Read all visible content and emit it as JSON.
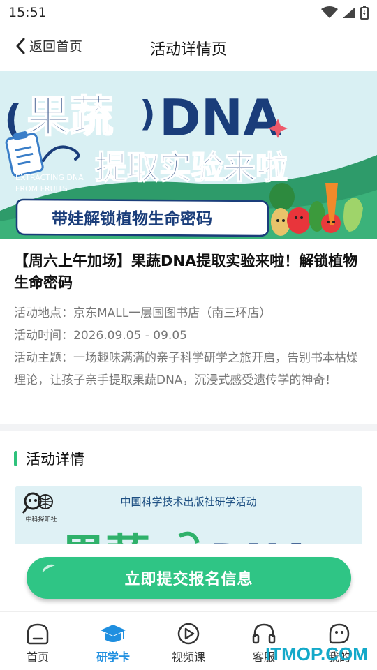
{
  "status_bar": {
    "time": "15:51"
  },
  "nav": {
    "back_label": "返回首页",
    "title": "活动详情页"
  },
  "banner": {
    "title_cn": "果蔬",
    "title_en": "DNA",
    "subtitle": "提取实验来啦",
    "english_line1": "EXTRACTING DNA",
    "english_line2": "FROM FRUITS",
    "ribbon": "带娃解锁植物生命密码"
  },
  "activity": {
    "headline": "【周六上午加场】果蔬DNA提取实验来啦！解锁植物生命密码",
    "location_label": "活动地点：",
    "location": "京东MALL一层国图书店（南三环店）",
    "time_label": "活动时间：",
    "time": "2026.09.05 - 09.05",
    "theme_label": "活动主题：",
    "theme": "一场趣味满满的亲子科学研学之旅开启，告别书本枯燥理论，让孩子亲手提取果蔬DNA，沉浸式感受遗传学的神奇！"
  },
  "detail": {
    "section_title": "活动详情",
    "poster_org": "中国科学技术出版社研学活动",
    "poster_logo_text": "中科探知社"
  },
  "cta": {
    "label": "立即提交报名信息"
  },
  "tabs": [
    {
      "label": "首页",
      "icon": "home-icon",
      "active": false
    },
    {
      "label": "研学卡",
      "icon": "graduation-cap-icon",
      "active": true
    },
    {
      "label": "视频课",
      "icon": "play-icon",
      "active": false
    },
    {
      "label": "客服",
      "icon": "headset-icon",
      "active": false
    },
    {
      "label": "我的",
      "icon": "profile-face-icon",
      "active": false
    }
  ],
  "watermark": "ITMOP.COM",
  "colors": {
    "accent_green": "#2fc585",
    "tab_active": "#1f8fe0",
    "banner_navy": "#1a3d7a"
  }
}
